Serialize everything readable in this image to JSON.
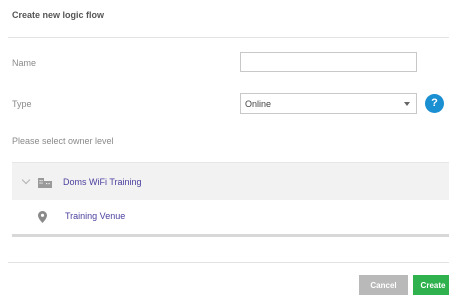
{
  "dialog": {
    "title": "Create new logic flow"
  },
  "form": {
    "name_label": "Name",
    "name_value": "",
    "name_placeholder": "",
    "type_label": "Type",
    "type_selected": "Online",
    "help_symbol": "?",
    "owner_label": "Please select owner level"
  },
  "tree": {
    "items": [
      {
        "label": "Doms WiFi Training",
        "icon": "building-icon",
        "expanded": false
      },
      {
        "label": "Training Venue",
        "icon": "location-pin-icon"
      }
    ]
  },
  "footer": {
    "cancel_label": "Cancel",
    "create_label": "Create"
  },
  "colors": {
    "accent_blue": "#1a8fd1",
    "link_purple": "#4a3f9e",
    "create_green": "#2fb24d",
    "cancel_gray": "#b9b9b9"
  }
}
